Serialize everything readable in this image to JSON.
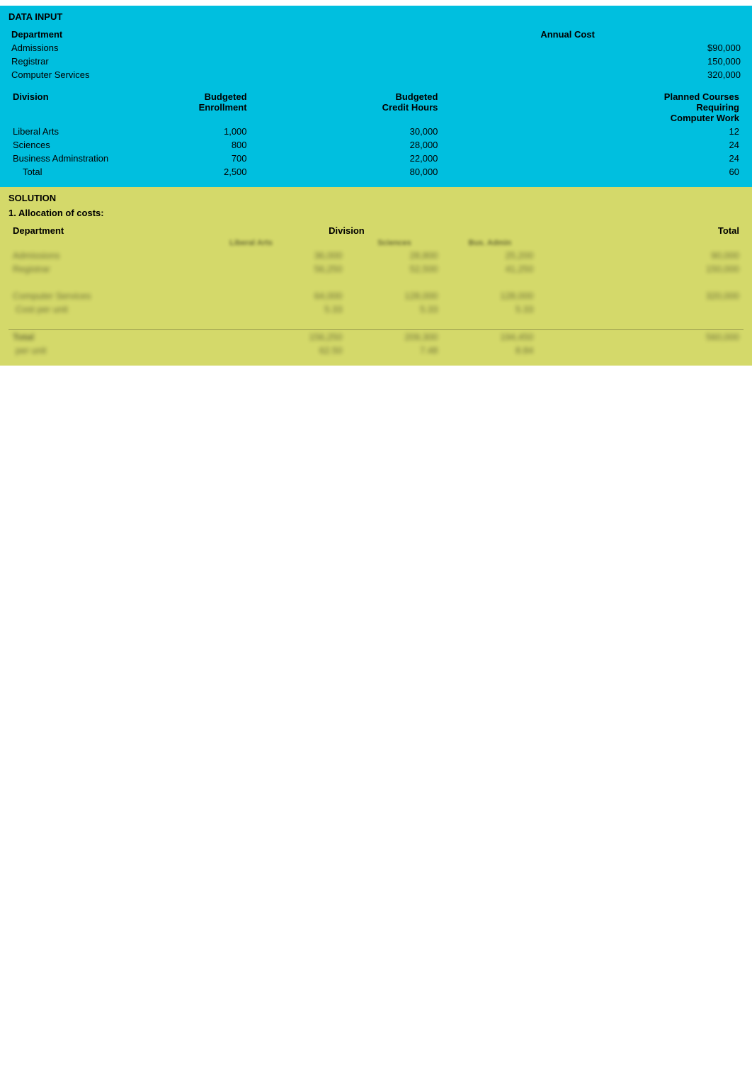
{
  "page": {
    "dataInput": {
      "title": "DATA INPUT",
      "deptTable": {
        "headers": {
          "col1": "Department",
          "col2": "",
          "col3": "",
          "col4": "",
          "col5": "",
          "annualCost": "Annual Cost"
        },
        "rows": [
          {
            "dept": "Admissions",
            "annualCost": "$90,000"
          },
          {
            "dept": "Registrar",
            "annualCost": "150,000"
          },
          {
            "dept": "Computer Services",
            "annualCost": "320,000"
          }
        ]
      },
      "divisionTable": {
        "col2Header": "Budgeted\nEnrollment",
        "col3Header": "Budgeted\nCredit Hours",
        "col4Header": "Planned Courses\nRequiring\nComputer Work",
        "divisionHeader": "Division",
        "rows": [
          {
            "division": "Liberal Arts",
            "enrollment": "1,000",
            "creditHours": "30,000",
            "computerWork": "12"
          },
          {
            "division": "Sciences",
            "enrollment": "800",
            "creditHours": "28,000",
            "computerWork": "24"
          },
          {
            "division": "Business Adminstration",
            "enrollment": "700",
            "creditHours": "22,000",
            "computerWork": "24"
          },
          {
            "division": "Total",
            "enrollment": "2,500",
            "creditHours": "80,000",
            "computerWork": "60",
            "isTotal": true
          }
        ]
      }
    },
    "solution": {
      "title": "SOLUTION",
      "allocationTitle": "1. Allocation of costs:",
      "table": {
        "deptHeader": "Department",
        "divisionHeader": "Division",
        "totalHeader": "Total",
        "subHeaders": [
          "Liberal Arts",
          "Sciences",
          "Business Admin"
        ],
        "rows": [
          {
            "dept": "Admissions",
            "col1": "36,000",
            "col2": "28,800",
            "col3": "25,200",
            "total": "90,000"
          },
          {
            "dept": "Registrar",
            "col1": "56,250",
            "col2": "52,500",
            "col3": "41,250",
            "total": "150,000"
          },
          {
            "dept": "",
            "col1": "",
            "col2": "",
            "col3": "",
            "total": ""
          },
          {
            "dept": "Computer Services",
            "col1": "64,000",
            "col2": "128,000",
            "col3": "128,000",
            "total": "320,000"
          },
          {
            "dept": "  Cost per unit",
            "col1": "",
            "col2": "",
            "col3": "",
            "total": ""
          },
          {
            "dept": "",
            "col1": "",
            "col2": "",
            "col3": "",
            "total": ""
          },
          {
            "dept": "Total",
            "col1": "156,250",
            "col2": "209,300",
            "col3": "194,450",
            "total": "560,000"
          },
          {
            "dept": "  per unit",
            "col1": "",
            "col2": "",
            "col3": "",
            "total": ""
          }
        ]
      }
    }
  }
}
